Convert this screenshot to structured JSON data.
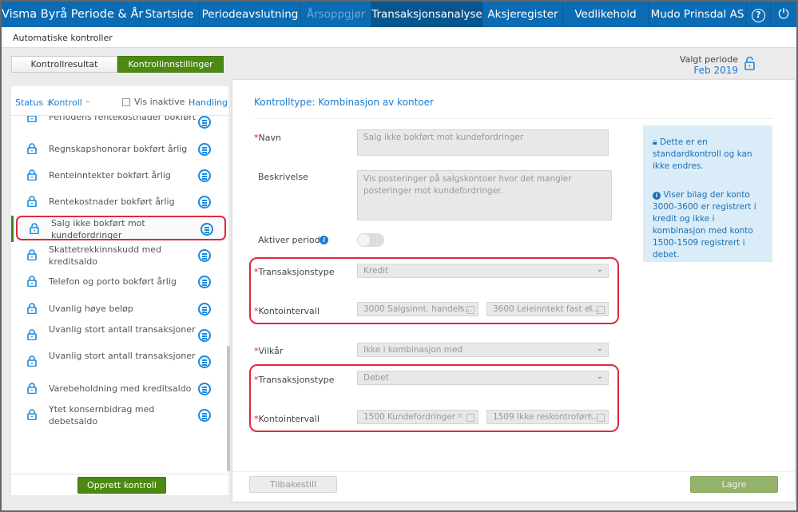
{
  "nav": {
    "title": "Visma Byrå Periode & År",
    "items": [
      {
        "label": "Startside"
      },
      {
        "label": "Periodeavslutning"
      },
      {
        "label": "Årsoppgjør"
      },
      {
        "label": "Transaksjonsanalyse"
      },
      {
        "label": "Aksjeregister"
      },
      {
        "label": "Vedlikehold"
      }
    ],
    "company": "Mudo Prinsdal AS",
    "help_icon": "?",
    "power_icon": "⏻"
  },
  "breadcrumb": "Automatiske kontroller",
  "tabs": {
    "result": "Kontrollresultat",
    "settings": "Kontrollinnstillinger"
  },
  "period": {
    "label": "Valgt periode",
    "value": "Feb 2019"
  },
  "list": {
    "headers": {
      "status": "Status",
      "kontroll": "Kontroll",
      "vis_inaktive": "Vis inaktive",
      "handling": "Handling"
    },
    "items": [
      {
        "label": "Periodens rentekostnader bokført"
      },
      {
        "label": "Regnskapshonorar bokført årlig"
      },
      {
        "label": "Renteinntekter bokført årlig"
      },
      {
        "label": "Rentekostnader bokført årlig"
      },
      {
        "label": "Salg ikke bokført mot kundefordringer"
      },
      {
        "label": "Skattetrekkinnskudd med kreditsaldo"
      },
      {
        "label": "Telefon og porto bokført årlig"
      },
      {
        "label": "Uvanlig høye beløp"
      },
      {
        "label": "Uvanlig stort antall transaksjoner"
      },
      {
        "label": "Uvanlig stort antall transaksjoner"
      },
      {
        "label": "Varebeholdning med kreditsaldo"
      },
      {
        "label": "Ytet konsernbidrag med debetsaldo"
      }
    ],
    "create_button": "Opprett kontroll"
  },
  "form": {
    "title": "Kontrolltype: Kombinasjon av kontoer",
    "navn_label": "Navn",
    "navn_value": "Salg ikke bokført mot kundefordringer",
    "beskrivelse_label": "Beskrivelse",
    "beskrivelse_value": "Vis posteringer på salgskontoer hvor det mangler posteringer mot kundefordringer.",
    "aktiver_label": "Aktiver periode",
    "trans1_label": "Transaksjonstype",
    "trans1_value": "Kredit",
    "konto1_label": "Kontointervall",
    "konto1_from": "3000 Salgsinnt. handels...",
    "konto1_to": "3600 Leieinntekt fast ei...",
    "vilkar_label": "Vilkår",
    "vilkar_value": "Ikke i kombinasjon med",
    "trans2_label": "Transaksjonstype",
    "trans2_value": "Debet",
    "konto2_label": "Kontointervall",
    "konto2_from": "1500 Kundefordringer",
    "konto2_to": "1509 Ikke reskontroført...",
    "reset": "Tilbakestill",
    "save": "Lagre"
  },
  "info": {
    "lock_text": "Dette er en standardkontroll og kan ikke endres.",
    "info_text": "Viser bilag der konto 3000-3600 er registrert i kredit og ikke i kombinasjon med konto 1500-1509 registrert i debet."
  },
  "colors": {
    "nav": "#0b6cb3",
    "green": "#4a8a10",
    "accent": "#1a8ae0",
    "red": "#e0293b"
  }
}
